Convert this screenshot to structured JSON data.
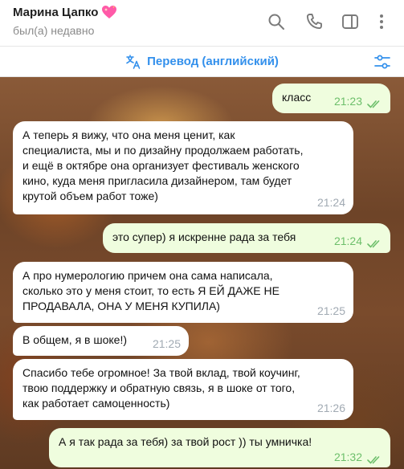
{
  "header": {
    "contact_name": "Марина Цапко",
    "emoji_icon": "sparkling-heart-icon",
    "status": "был(а) недавно",
    "actions": [
      "search-icon",
      "phone-icon",
      "sidebar-panel-icon",
      "more-vertical-icon"
    ]
  },
  "translate_bar": {
    "label": "Перевод (английский)",
    "icon": "translate-icon",
    "settings_icon": "settings-sliders-icon"
  },
  "colors": {
    "accent": "#3390ec",
    "outgoing_bubble": "#effdde",
    "incoming_bubble": "#ffffff",
    "outgoing_time": "#6dbf6b",
    "incoming_time": "#a1aab3"
  },
  "messages": [
    {
      "direction": "out",
      "text": "класс",
      "time": "21:23",
      "read": true
    },
    {
      "direction": "in",
      "text": "А теперь я вижу, что она меня ценит, как\nспециалиста, мы и по дизайну продолжаем работать,\nи ещё в октябре она организует фестиваль женского\nкино, куда меня пригласила дизайнером, там  будет\nкрутой объем работ тоже)",
      "time": "21:24"
    },
    {
      "direction": "out",
      "text": "это супер) я искренне рада за тебя",
      "time": "21:24",
      "read": true
    },
    {
      "direction": "in",
      "text": "А про нумерологию причем она сама написала,\nсколько это у меня стоит, то есть Я ЕЙ ДАЖЕ НЕ\nПРОДАВАЛА, ОНА У МЕНЯ КУПИЛА)",
      "time": "21:25"
    },
    {
      "direction": "in",
      "text": "В общем, я в шоке!)",
      "time": "21:25"
    },
    {
      "direction": "in",
      "text": "Спасибо тебе огромное! За твой вклад, твой коучинг,\nтвою поддержку и обратную связь, я в шоке от того,\nкак работает самоценность)",
      "time": "21:26"
    },
    {
      "direction": "out",
      "text": "А я так рада  за тебя) за твой рост )) ты умничка!",
      "time": "21:32",
      "read": true
    }
  ]
}
